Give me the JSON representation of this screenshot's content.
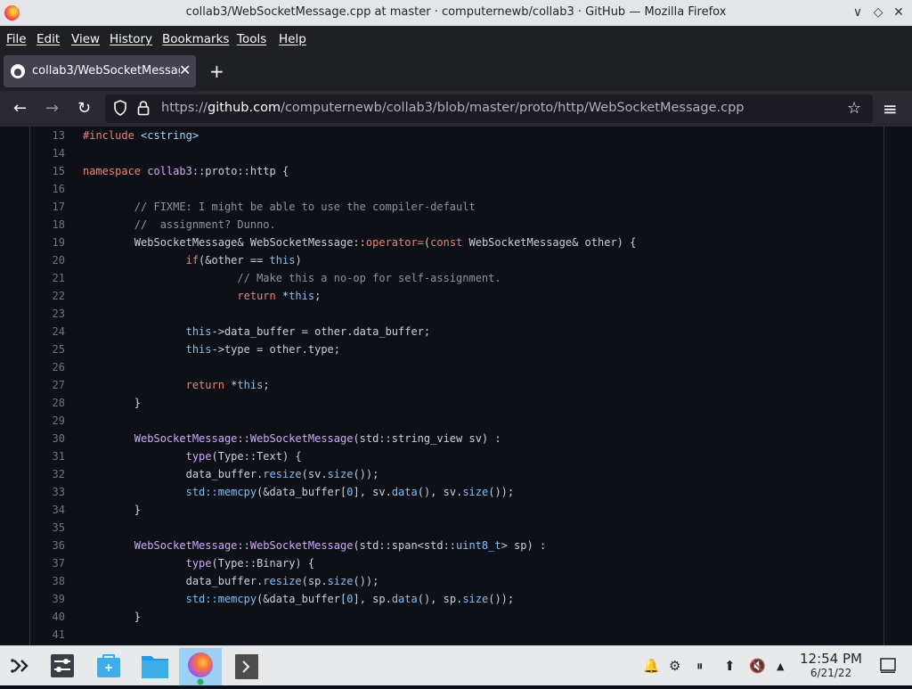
{
  "window": {
    "title": "collab3/WebSocketMessage.cpp at master · computernewb/collab3 · GitHub — Mozilla Firefox",
    "controls": {
      "minimize": "∨",
      "maximize": "◇",
      "close": "✕"
    }
  },
  "menu": [
    "File",
    "Edit",
    "View",
    "History",
    "Bookmarks",
    "Tools",
    "Help"
  ],
  "tab": {
    "label": "collab3/WebSocketMessag",
    "close": "✕",
    "new_tab": "+"
  },
  "nav": {
    "back": "←",
    "forward": "→",
    "reload": "↻",
    "url_prefix": "https://",
    "url_host": "github.com",
    "url_path": "/computernewb/collab3/blob/master/proto/http/WebSocketMessage.cpp",
    "bookmark": "☆",
    "menu": "≡"
  },
  "colors": {
    "kw": "#ff7b72",
    "fn": "#d2a8ff",
    "cm": "#8b949e",
    "c": "#79c0ff",
    "s": "#a5d6ff",
    "n": "#c9d1d9"
  },
  "code": [
    {
      "num": "13",
      "tokens": [
        [
          "kw",
          "#include"
        ],
        [
          "n",
          " "
        ],
        [
          "s",
          "<cstring>"
        ]
      ]
    },
    {
      "num": "14",
      "tokens": []
    },
    {
      "num": "15",
      "tokens": [
        [
          "kw",
          "namespace"
        ],
        [
          "n",
          " "
        ],
        [
          "fn",
          "collab3"
        ],
        [
          "n",
          "::proto::http {"
        ]
      ]
    },
    {
      "num": "16",
      "tokens": []
    },
    {
      "num": "17",
      "tokens": [
        [
          "n",
          "        "
        ],
        [
          "cm",
          "// FIXME: I might be able to use the compiler-default"
        ]
      ]
    },
    {
      "num": "18",
      "tokens": [
        [
          "n",
          "        "
        ],
        [
          "cm",
          "//  assignment? Dunno."
        ]
      ]
    },
    {
      "num": "19",
      "tokens": [
        [
          "n",
          "        WebSocketMessage& WebSocketMessage::"
        ],
        [
          "kw",
          "operator="
        ],
        [
          "n",
          "("
        ],
        [
          "kw",
          "const"
        ],
        [
          "n",
          " WebSocketMessage& other) {"
        ]
      ]
    },
    {
      "num": "20",
      "tokens": [
        [
          "n",
          "                "
        ],
        [
          "kw",
          "if"
        ],
        [
          "n",
          "(&other == "
        ],
        [
          "c",
          "this"
        ],
        [
          "n",
          ")"
        ]
      ]
    },
    {
      "num": "21",
      "tokens": [
        [
          "n",
          "                        "
        ],
        [
          "cm",
          "// Make this a no-op for self-assignment."
        ]
      ]
    },
    {
      "num": "22",
      "tokens": [
        [
          "n",
          "                        "
        ],
        [
          "kw",
          "return"
        ],
        [
          "n",
          " *"
        ],
        [
          "c",
          "this"
        ],
        [
          "n",
          ";"
        ]
      ]
    },
    {
      "num": "23",
      "tokens": []
    },
    {
      "num": "24",
      "tokens": [
        [
          "n",
          "                "
        ],
        [
          "c",
          "this"
        ],
        [
          "n",
          "->data_buffer = other.data_buffer;"
        ]
      ]
    },
    {
      "num": "25",
      "tokens": [
        [
          "n",
          "                "
        ],
        [
          "c",
          "this"
        ],
        [
          "n",
          "->type = other.type;"
        ]
      ]
    },
    {
      "num": "26",
      "tokens": []
    },
    {
      "num": "27",
      "tokens": [
        [
          "n",
          "                "
        ],
        [
          "kw",
          "return"
        ],
        [
          "n",
          " *"
        ],
        [
          "c",
          "this"
        ],
        [
          "n",
          ";"
        ]
      ]
    },
    {
      "num": "28",
      "tokens": [
        [
          "n",
          "        }"
        ]
      ]
    },
    {
      "num": "29",
      "tokens": []
    },
    {
      "num": "30",
      "tokens": [
        [
          "n",
          "        "
        ],
        [
          "fn",
          "WebSocketMessage"
        ],
        [
          "n",
          "::"
        ],
        [
          "fn",
          "WebSocketMessage"
        ],
        [
          "n",
          "(std::string_view sv) :"
        ]
      ]
    },
    {
      "num": "31",
      "tokens": [
        [
          "n",
          "                "
        ],
        [
          "fn",
          "type"
        ],
        [
          "n",
          "(Type::Text) {"
        ]
      ]
    },
    {
      "num": "32",
      "tokens": [
        [
          "n",
          "                data_buffer."
        ],
        [
          "c",
          "resize"
        ],
        [
          "n",
          "(sv."
        ],
        [
          "c",
          "size"
        ],
        [
          "n",
          "());"
        ]
      ]
    },
    {
      "num": "33",
      "tokens": [
        [
          "n",
          "                "
        ],
        [
          "c",
          "std::memcpy"
        ],
        [
          "n",
          "(&data_buffer["
        ],
        [
          "c",
          "0"
        ],
        [
          "n",
          "], sv."
        ],
        [
          "c",
          "data"
        ],
        [
          "n",
          "(), sv."
        ],
        [
          "c",
          "size"
        ],
        [
          "n",
          "());"
        ]
      ]
    },
    {
      "num": "34",
      "tokens": [
        [
          "n",
          "        }"
        ]
      ]
    },
    {
      "num": "35",
      "tokens": []
    },
    {
      "num": "36",
      "tokens": [
        [
          "n",
          "        "
        ],
        [
          "fn",
          "WebSocketMessage"
        ],
        [
          "n",
          "::"
        ],
        [
          "fn",
          "WebSocketMessage"
        ],
        [
          "n",
          "(std::span<std::"
        ],
        [
          "c",
          "uint8_t"
        ],
        [
          "n",
          "> sp) :"
        ]
      ]
    },
    {
      "num": "37",
      "tokens": [
        [
          "n",
          "                "
        ],
        [
          "fn",
          "type"
        ],
        [
          "n",
          "(Type::Binary) {"
        ]
      ]
    },
    {
      "num": "38",
      "tokens": [
        [
          "n",
          "                data_buffer."
        ],
        [
          "c",
          "resize"
        ],
        [
          "n",
          "(sp."
        ],
        [
          "c",
          "size"
        ],
        [
          "n",
          "());"
        ]
      ]
    },
    {
      "num": "39",
      "tokens": [
        [
          "n",
          "                "
        ],
        [
          "c",
          "std::memcpy"
        ],
        [
          "n",
          "(&data_buffer["
        ],
        [
          "c",
          "0"
        ],
        [
          "n",
          "], sp."
        ],
        [
          "c",
          "data"
        ],
        [
          "n",
          "(), sp."
        ],
        [
          "c",
          "size"
        ],
        [
          "n",
          "());"
        ]
      ]
    },
    {
      "num": "40",
      "tokens": [
        [
          "n",
          "        }"
        ]
      ]
    },
    {
      "num": "41",
      "tokens": []
    }
  ],
  "taskbar": {
    "apps": [
      "application-launcher-icon",
      "settings-icon",
      "discover-store-icon",
      "file-manager-icon",
      "firefox-icon",
      "terminal-icon"
    ],
    "tray": {
      "notifications": "🔔",
      "network": "⚙",
      "media": "⏸",
      "updates": "⬆",
      "volume": "🔇",
      "expand": "▲"
    },
    "time": "12:54 PM",
    "date": "6/21/22"
  }
}
